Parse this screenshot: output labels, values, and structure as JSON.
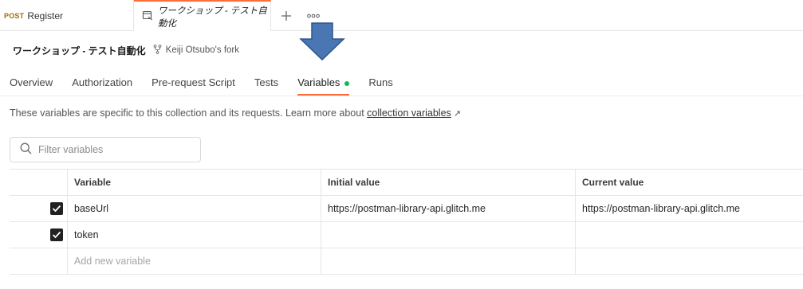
{
  "tabs": {
    "register": {
      "method": "POST",
      "label": "Register"
    },
    "active": {
      "label": "ワークショップ - テスト自動化"
    },
    "add_icon": "plus-icon",
    "more_icon": "more-dots-icon"
  },
  "collection": {
    "name": "ワークショップ - テスト自動化",
    "fork_label": "Keiji Otsubo's fork"
  },
  "subtabs": [
    "Overview",
    "Authorization",
    "Pre-request Script",
    "Tests",
    "Variables",
    "Runs"
  ],
  "active_subtab": "Variables",
  "description": {
    "text": "These variables are specific to this collection and its requests. Learn more about ",
    "link": "collection variables",
    "link_icon": "↗"
  },
  "filter": {
    "placeholder": "Filter variables"
  },
  "table": {
    "headers": {
      "variable": "Variable",
      "initial": "Initial value",
      "current": "Current value"
    },
    "rows": [
      {
        "checked": true,
        "variable": "baseUrl",
        "initial": "https://postman-library-api.glitch.me",
        "current": "https://postman-library-api.glitch.me"
      },
      {
        "checked": true,
        "variable": "token",
        "initial": "",
        "current": ""
      }
    ],
    "new_placeholder": "Add new variable"
  },
  "colors": {
    "accent": "#ff6c37",
    "active_dot": "#0cbb52",
    "arrow": "#4a77b4"
  }
}
